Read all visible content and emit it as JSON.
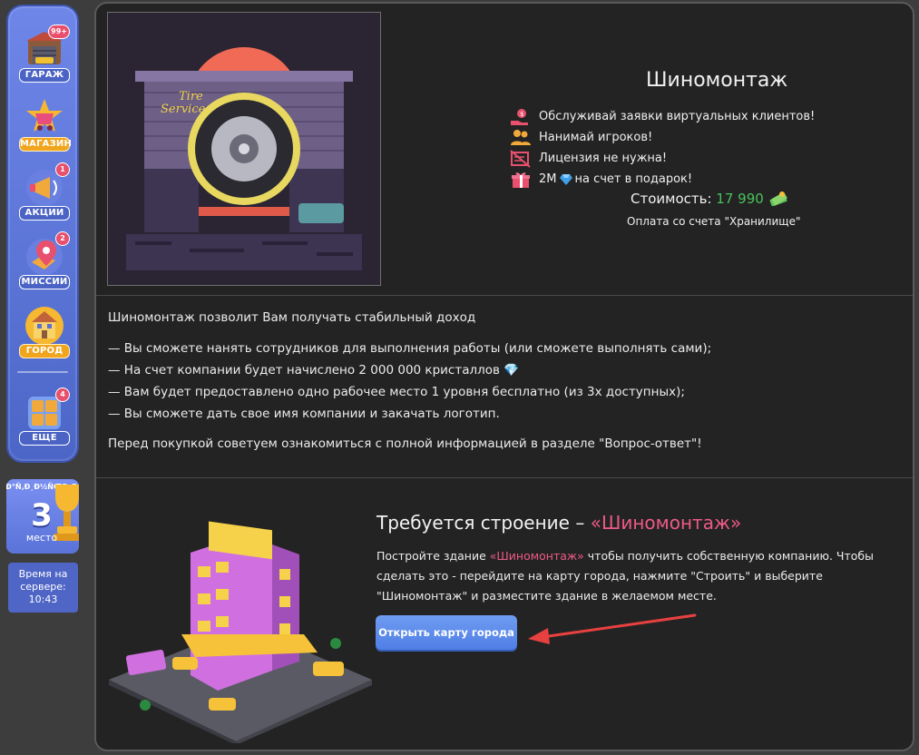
{
  "sidebar": {
    "items": [
      {
        "label": "ГАРАЖ",
        "badge": "99+",
        "icon": "garage-icon"
      },
      {
        "label": "МАГАЗИН",
        "badge": "",
        "icon": "shop-icon"
      },
      {
        "label": "АКЦИИ",
        "badge": "1",
        "icon": "megaphone-icon"
      },
      {
        "label": "МИССИИ",
        "badge": "2",
        "icon": "map-pin-icon"
      },
      {
        "label": "ГОРОД",
        "badge": "",
        "icon": "city-icon"
      },
      {
        "label": "ЕЩЕ",
        "badge": "4",
        "icon": "grid-icon"
      }
    ]
  },
  "rank": {
    "garbled": "»Ð°Ñ‚Ð¸Ð½ÑŒÐ¸Ð¾Ñ",
    "number": "3",
    "label": "место"
  },
  "server_time": {
    "label_line1": "Время на",
    "label_line2": "сервере:",
    "time": "10:43"
  },
  "product": {
    "title": "Шиномонтаж",
    "features": [
      "Обслуживай заявки виртуальных клиентов!",
      "Нанимай игроков!",
      "Лицензия не нужна!"
    ],
    "gift_prefix": "2M",
    "gift_suffix": "на счет в подарок!",
    "cost_label": "Стоимость:",
    "cost_value": "17 990",
    "payment_note": "Оплата со счета \"Хранилище\""
  },
  "description": {
    "intro": "Шиномонтаж позволит Вам получать стабильный доход",
    "bullets": [
      "— Вы сможете нанять сотрудников для выполнения работы (или сможете выполнять сами);",
      "— На счет компании будет начислено 2 000 000 кристаллов 💎",
      "— Вам будет предоставлено одно рабочее место 1 уровня бесплатно (из 3х доступных);",
      "— Вы сможете дать свое имя компании и закачать логотип."
    ],
    "outro": "Перед покупкой советуем ознакомиться с полной информацией в разделе \"Вопрос-ответ\"!"
  },
  "requirement": {
    "title_prefix": "Требуется строение – ",
    "title_highlight": "«Шиномонтаж»",
    "text_prefix": "Постройте здание ",
    "text_highlight": "«Шиномонтаж»",
    "text_suffix": " чтобы получить собственную компанию. Чтобы сделать это - перейдите на карту города, нажмите \"Строить\" и выберите \"Шиномонтаж\" и разместите здание в желаемом месте.",
    "button_label": "Открыть карту города"
  },
  "hero_sign": {
    "line1": "Tire",
    "line2": "Service"
  },
  "colors": {
    "accent_blue": "#5a74d6",
    "highlight_pink": "#ee5a86",
    "price_green": "#48c25c",
    "panel_bg": "#232323"
  }
}
